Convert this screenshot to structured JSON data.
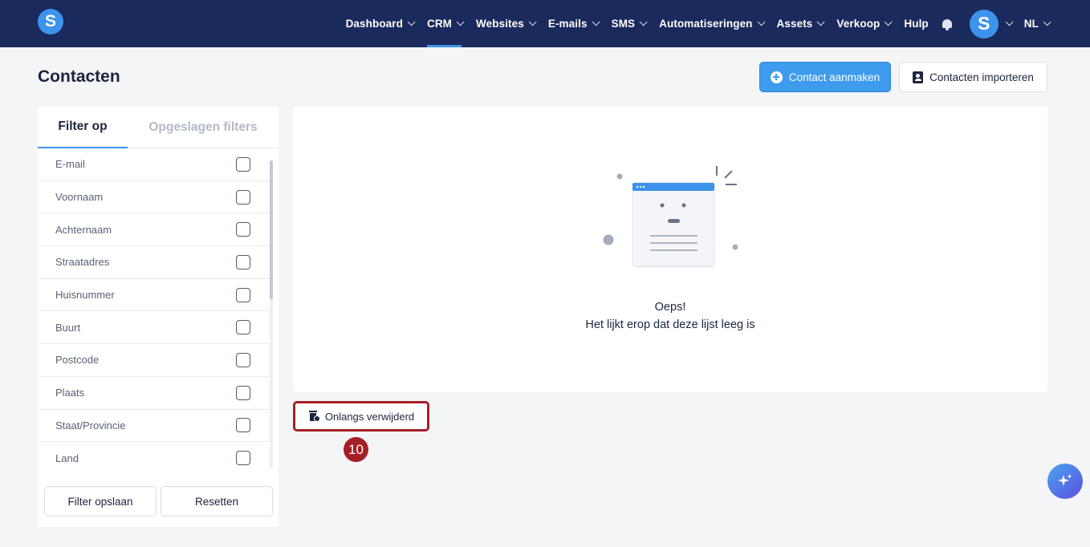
{
  "nav": {
    "logo_letter": "S",
    "items": [
      {
        "label": "Dashboard",
        "has_dropdown": true,
        "active": false
      },
      {
        "label": "CRM",
        "has_dropdown": true,
        "active": true
      },
      {
        "label": "Websites",
        "has_dropdown": true,
        "active": false
      },
      {
        "label": "E-mails",
        "has_dropdown": true,
        "active": false
      },
      {
        "label": "SMS",
        "has_dropdown": true,
        "active": false
      },
      {
        "label": "Automatiseringen",
        "has_dropdown": true,
        "active": false
      },
      {
        "label": "Assets",
        "has_dropdown": true,
        "active": false
      },
      {
        "label": "Verkoop",
        "has_dropdown": true,
        "active": false
      },
      {
        "label": "Hulp",
        "has_dropdown": false,
        "active": false
      }
    ],
    "avatar_letter": "S",
    "language": "NL"
  },
  "header": {
    "title": "Contacten",
    "create_label": "Contact aanmaken",
    "import_label": "Contacten importeren"
  },
  "filters": {
    "tab_active": "Filter op",
    "tab_saved": "Opgeslagen filters",
    "items": [
      "E-mail",
      "Voornaam",
      "Achternaam",
      "Straatadres",
      "Huisnummer",
      "Buurt",
      "Postcode",
      "Plaats",
      "Staat/Provincie",
      "Land"
    ],
    "save_label": "Filter opslaan",
    "reset_label": "Resetten"
  },
  "empty_state": {
    "title": "Oeps!",
    "subtitle": "Het lijkt erop dat deze lijst leeg is"
  },
  "recently_deleted": {
    "label": "Onlangs verwijderd",
    "step": "10"
  },
  "colors": {
    "nav_bg": "#1a2a5c",
    "accent": "#3d93ec",
    "highlight": "#a51f26"
  }
}
